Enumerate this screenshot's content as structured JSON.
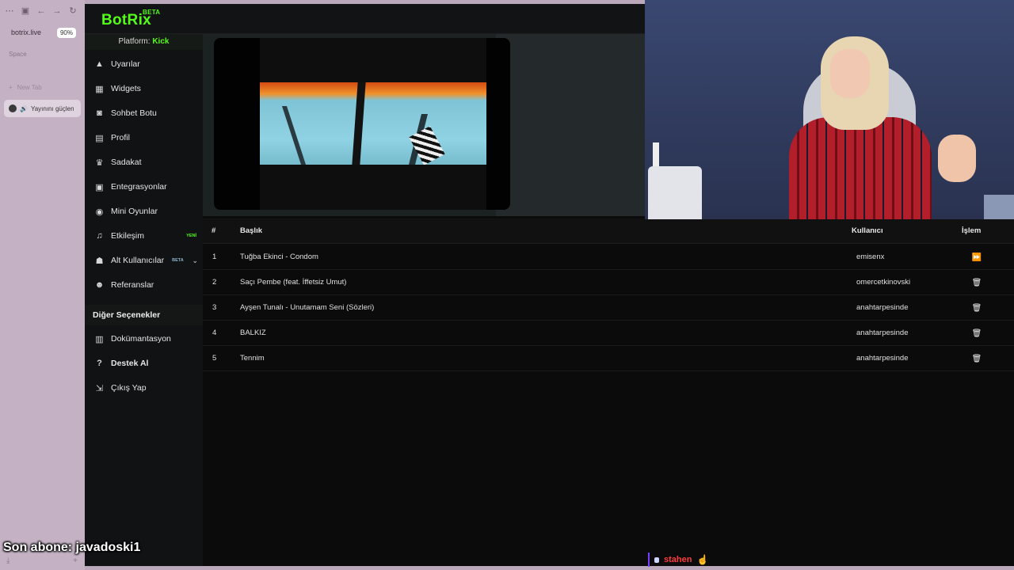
{
  "browser": {
    "host": "botrix.live",
    "zoom": "90%",
    "space_label": "Space",
    "new_tab_label": "New Tab",
    "active_tab_title": "Yayınını güçlen"
  },
  "app": {
    "logo": "BotRix",
    "logo_badge": "BETA",
    "platform_prefix": "Platform:",
    "platform_name": "Kick"
  },
  "sidebar": {
    "items": [
      {
        "label": "Uyarılar",
        "icon": "warning-icon"
      },
      {
        "label": "Widgets",
        "icon": "grid-icon"
      },
      {
        "label": "Sohbet Botu",
        "icon": "robot-icon"
      },
      {
        "label": "Profil",
        "icon": "id-card-icon"
      },
      {
        "label": "Sadakat",
        "icon": "trophy-icon"
      },
      {
        "label": "Entegrasyonlar",
        "icon": "plug-icon"
      },
      {
        "label": "Mini Oyunlar",
        "icon": "gamepad-icon"
      },
      {
        "label": "Etkileşim",
        "icon": "music-icon",
        "badge": "YENİ"
      },
      {
        "label": "Alt Kullanıcılar",
        "icon": "users-icon",
        "badge": "BETA"
      },
      {
        "label": "Referanslar",
        "icon": "user-group-icon"
      }
    ],
    "section_title": "Diğer Seçenekler",
    "other_items": [
      {
        "label": "Dokümantasyon",
        "icon": "document-icon"
      },
      {
        "label": "Destek Al",
        "icon": "question-icon"
      },
      {
        "label": "Çıkış Yap",
        "icon": "logout-icon"
      }
    ]
  },
  "table": {
    "headers": {
      "num": "#",
      "title": "Başlık",
      "user": "Kullanıcı",
      "action": "İşlem"
    },
    "rows": [
      {
        "num": "1",
        "title": "Tuğba Ekinci - Condom",
        "user": "emisenx",
        "action": "skip-icon"
      },
      {
        "num": "2",
        "title": "Saçı Pembe (feat. İffetsiz Umut)",
        "user": "omercetkinovski",
        "action": "trash-icon"
      },
      {
        "num": "3",
        "title": "Ayşen Tunalı - Unutamam Seni (Sözleri)",
        "user": "anahtarpesinde",
        "action": "trash-icon"
      },
      {
        "num": "4",
        "title": "BALKIZ",
        "user": "anahtarpesinde",
        "action": "trash-icon"
      },
      {
        "num": "5",
        "title": "Tennim",
        "user": "anahtarpesinde",
        "action": "trash-icon"
      }
    ]
  },
  "overlay": {
    "subscriber_text": "Son abone: javadoski1",
    "chat_username": "stahen"
  },
  "colors": {
    "accent_green": "#53fc18",
    "chat_name_red": "#ff3b3b",
    "new_badge": "#53fc18",
    "beta_badge": "#8fb3c9"
  }
}
